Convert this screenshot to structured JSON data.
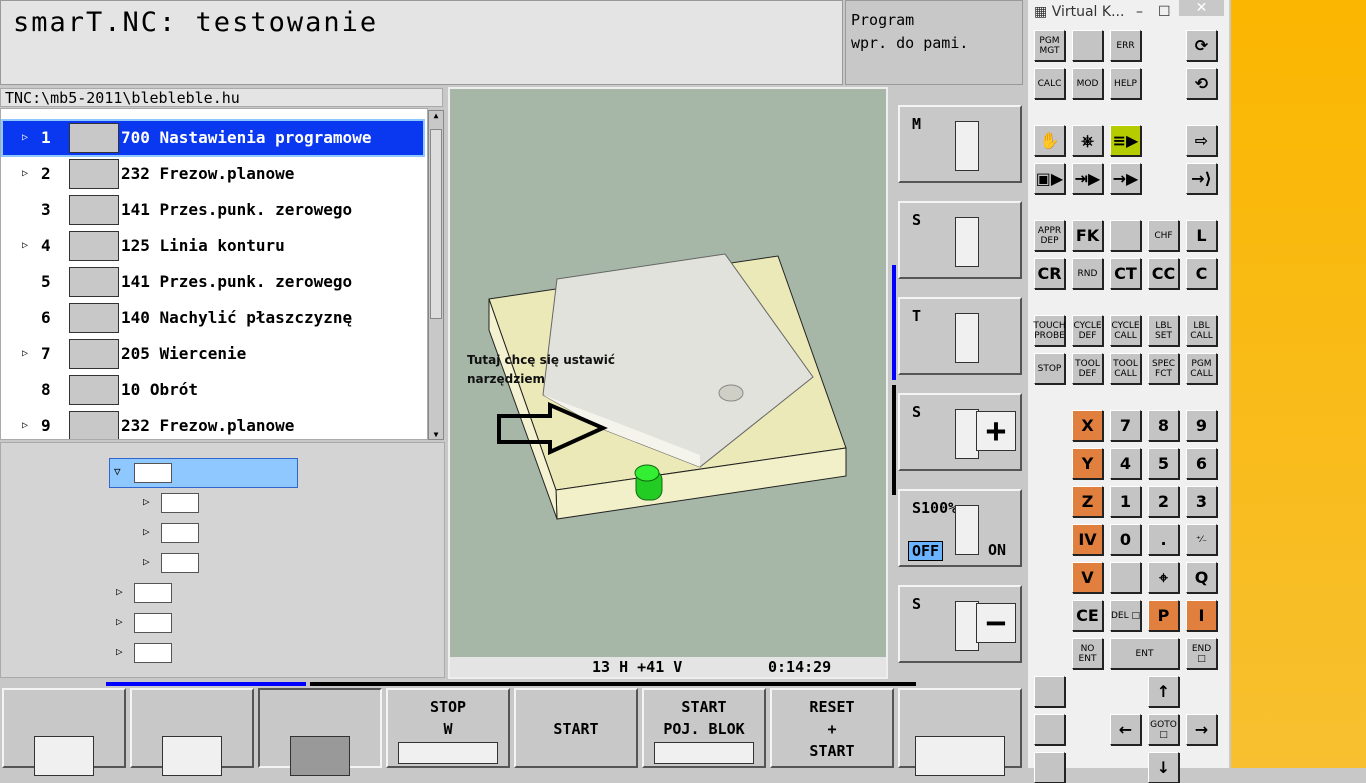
{
  "header": {
    "title": "smarT.NC: testowanie",
    "mode": [
      "Program",
      "wpr. do pami."
    ]
  },
  "path": "TNC:\\mb5-2011\\blebleble.hu",
  "program": [
    {
      "n": "1",
      "text": "700 Nastawienia programowe",
      "expand": true,
      "selected": true,
      "icon": "program-settings-icon"
    },
    {
      "n": "2",
      "text": "232 Frezow.planowe",
      "expand": true,
      "icon": "face-milling-icon"
    },
    {
      "n": "3",
      "text": "141 Przes.punk. zerowego",
      "expand": false,
      "icon": "datum-shift-icon"
    },
    {
      "n": "4",
      "text": "125 Linia konturu",
      "expand": true,
      "icon": "contour-train-icon"
    },
    {
      "n": "5",
      "text": "141 Przes.punk. zerowego",
      "expand": false,
      "icon": "datum-shift-icon"
    },
    {
      "n": "6",
      "text": "140 Nachylić płaszczyznę",
      "expand": false,
      "icon": "tilt-plane-icon"
    },
    {
      "n": "7",
      "text": "205 Wiercenie",
      "expand": true,
      "icon": "drilling-icon"
    },
    {
      "n": "8",
      "text": "10 Obrót",
      "expand": false,
      "icon": "rotation-icon"
    },
    {
      "n": "9",
      "text": "232 Frezow.planowe",
      "expand": true,
      "icon": "face-milling-icon"
    }
  ],
  "graphics": {
    "annotation": [
      "Tutaj chcę się ustawić",
      "narzędziem"
    ],
    "status": "13 H +41 V",
    "time": "0:14:29",
    "colors": {
      "bg": "#a6b7a7",
      "stock": "#ece9b8",
      "part": "#e0e0da",
      "tool": "#22cc22"
    }
  },
  "right_softkeys": [
    {
      "label": "M",
      "icon": "machine-icon"
    },
    {
      "label": "S",
      "icon": "spindle-icon"
    },
    {
      "label": "T",
      "icon": "tool-change-icon"
    },
    {
      "label": "S",
      "icon": "spindle-override-plus-icon",
      "sign": "+"
    },
    {
      "label": "S100%",
      "icon": "spindle-100-icon",
      "off": "OFF",
      "on": "ON"
    },
    {
      "label": "S",
      "icon": "spindle-override-minus-icon",
      "sign": "−"
    }
  ],
  "bottom_softkeys": [
    {
      "label": "",
      "icon": "program-view-icon"
    },
    {
      "label": "",
      "icon": "program-graphics-view-icon"
    },
    {
      "label": "",
      "icon": "3d-block-icon"
    },
    {
      "label": "STOP\nW",
      "icon": "stop-at-block-icon"
    },
    {
      "label": "START",
      "icon": ""
    },
    {
      "label": "START\nPOJ. BLOK",
      "icon": "single-block-icon"
    },
    {
      "label": "RESET\n+\nSTART",
      "icon": ""
    },
    {
      "label": "",
      "icon": "next-softkey-row-icon"
    }
  ],
  "keyboard": {
    "title": "Virtual K...",
    "rows": [
      [
        "PGM MGT",
        "",
        "ERR",
        null,
        "⟳"
      ],
      [
        "CALC",
        "MOD",
        "HELP",
        null,
        "⟲"
      ],
      [
        "✋",
        "⎈",
        "≡▶",
        null,
        "⇨"
      ],
      [
        "▣▶",
        "⇥▶",
        "→▶",
        null,
        "→⟩"
      ],
      [
        "APPR DEP",
        "FK",
        "",
        "CHF",
        "L"
      ],
      [
        "CR",
        "RND",
        "CT",
        "CC",
        "C"
      ],
      [
        "TOUCH PROBE",
        "CYCLE DEF",
        "CYCLE CALL",
        "LBL SET",
        "LBL CALL"
      ],
      [
        "STOP",
        "TOOL DEF",
        "TOOL CALL",
        "SPEC FCT",
        "PGM CALL"
      ],
      [
        null,
        "X",
        "7",
        "8",
        "9"
      ],
      [
        null,
        "Y",
        "4",
        "5",
        "6"
      ],
      [
        null,
        "Z",
        "1",
        "2",
        "3"
      ],
      [
        null,
        "IV",
        "0",
        ".",
        "⁺⁄₋"
      ],
      [
        null,
        "V",
        "",
        "⌖",
        "Q"
      ],
      [
        null,
        "CE",
        "DEL □",
        "P",
        "I"
      ],
      [
        null,
        "NO ENT",
        "ENT",
        null,
        "END □"
      ],
      [
        "",
        null,
        null,
        "↑",
        null
      ],
      [
        "",
        null,
        "←",
        "GOTO □",
        "→"
      ],
      [
        "",
        null,
        null,
        "↓",
        null
      ]
    ],
    "orange": [
      "X",
      "Y",
      "Z",
      "IV",
      "V",
      "P",
      "I"
    ],
    "green": [
      "≡▶"
    ],
    "accent_orange": "#e07f3e",
    "accent_green": "#b4cc00"
  }
}
